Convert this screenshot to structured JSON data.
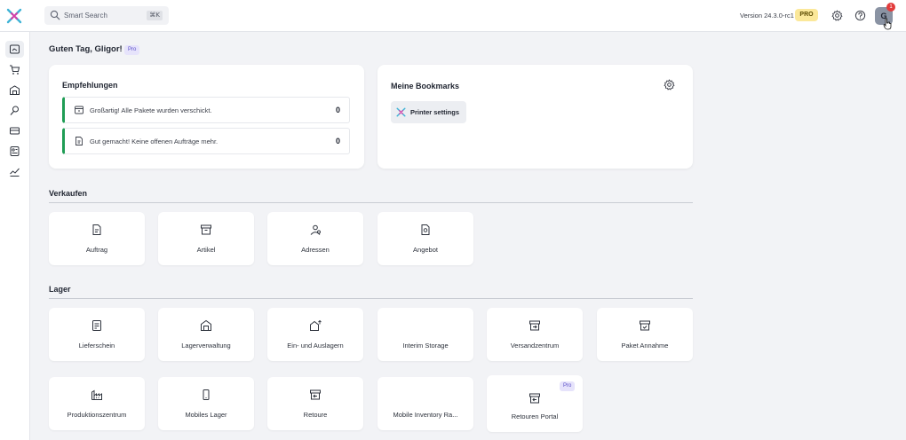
{
  "header": {
    "search_placeholder": "Smart Search",
    "search_shortcut": "⌘K",
    "version": "Version 24.3.0-rc1",
    "plan_badge": "PRO",
    "avatar_initial": "G",
    "notification_count": "1"
  },
  "sidebar": {
    "items": [
      {
        "icon": "dashboard-icon",
        "active": true
      },
      {
        "icon": "cart-icon",
        "active": false
      },
      {
        "icon": "warehouse-icon",
        "active": false
      },
      {
        "icon": "pin-icon",
        "active": false
      },
      {
        "icon": "truck-icon",
        "active": false
      },
      {
        "icon": "id-card-icon",
        "active": false
      },
      {
        "icon": "chart-icon",
        "active": false
      }
    ]
  },
  "greeting": {
    "text": "Guten Tag, Gligor!",
    "badge": "Pro"
  },
  "recommendations": {
    "title": "Empfehlungen",
    "items": [
      {
        "text": "Großartig! Alle Pakete wurden verschickt.",
        "count": "0"
      },
      {
        "text": "Gut gemacht! Keine offenen Aufträge mehr.",
        "count": "0"
      }
    ]
  },
  "bookmarks": {
    "title": "Meine Bookmarks",
    "items": [
      {
        "label": "Printer settings"
      }
    ]
  },
  "sections": {
    "verkaufen": {
      "title": "Verkaufen",
      "tiles": [
        {
          "label": "Auftrag",
          "icon": "order-document-icon"
        },
        {
          "label": "Artikel",
          "icon": "box-icon"
        },
        {
          "label": "Adressen",
          "icon": "contacts-icon"
        },
        {
          "label": "Angebot",
          "icon": "offer-tag-icon"
        }
      ]
    },
    "lager": {
      "title": "Lager",
      "tiles": [
        {
          "label": "Lieferschein",
          "icon": "delivery-note-icon"
        },
        {
          "label": "Lagerverwaltung",
          "icon": "warehouse-icon"
        },
        {
          "label": "Ein- und Auslagern",
          "icon": "stock-in-out-icon"
        },
        {
          "label": "Interim Storage",
          "icon": ""
        },
        {
          "label": "Versandzentrum",
          "icon": "shipping-box-icon"
        },
        {
          "label": "Paket Annahme",
          "icon": "package-check-icon"
        },
        {
          "label": "Produktionszentrum",
          "icon": "factory-icon"
        },
        {
          "label": "Mobiles Lager",
          "icon": "mobile-icon"
        },
        {
          "label": "Retoure",
          "icon": "return-box-icon"
        },
        {
          "label": "Mobile Inventory Ra...",
          "icon": ""
        },
        {
          "label": "Retouren Portal",
          "icon": "return-portal-icon",
          "badge": "Pro"
        }
      ]
    }
  },
  "colors": {
    "accent_green": "#1f9d55",
    "pro_yellow": "#fbe89a",
    "pro_purple": "#e6e3fb",
    "notification_red": "#e23b3b"
  }
}
